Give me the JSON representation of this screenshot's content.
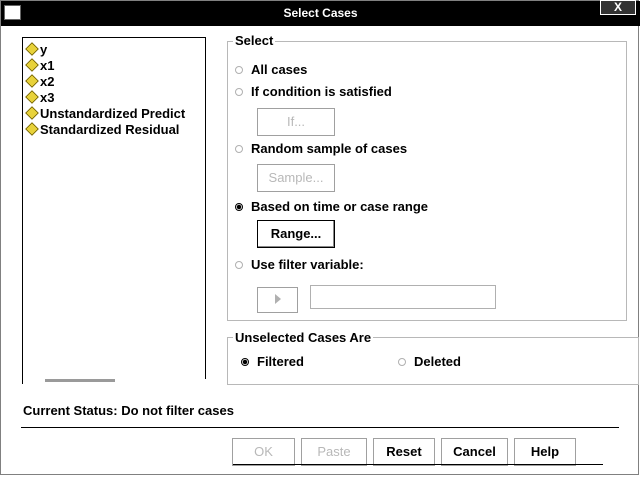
{
  "window": {
    "title": "Select Cases",
    "close_label": "X"
  },
  "variables": [
    "y",
    "x1",
    "x2",
    "x3",
    "Unstandardized Predict",
    "Standardized Residual"
  ],
  "select_group": {
    "label": "Select",
    "options": {
      "all_cases": "All cases",
      "if_condition": "If condition is satisfied",
      "random_sample": "Random sample of cases",
      "time_range": "Based on time or case range",
      "filter_variable": "Use filter variable:"
    },
    "selected": "time_range",
    "buttons": {
      "if": "If...",
      "sample": "Sample...",
      "range": "Range..."
    },
    "filter_value": ""
  },
  "unselected_group": {
    "label": "Unselected Cases Are",
    "options": {
      "filtered": "Filtered",
      "deleted": "Deleted"
    },
    "selected": "filtered"
  },
  "status": "Current Status: Do not filter cases",
  "footer_buttons": {
    "ok": "OK",
    "paste": "Paste",
    "reset": "Reset",
    "cancel": "Cancel",
    "help": "Help"
  },
  "colors": {
    "titlebar": "#000000",
    "variable_icon": "#e8d23a"
  }
}
